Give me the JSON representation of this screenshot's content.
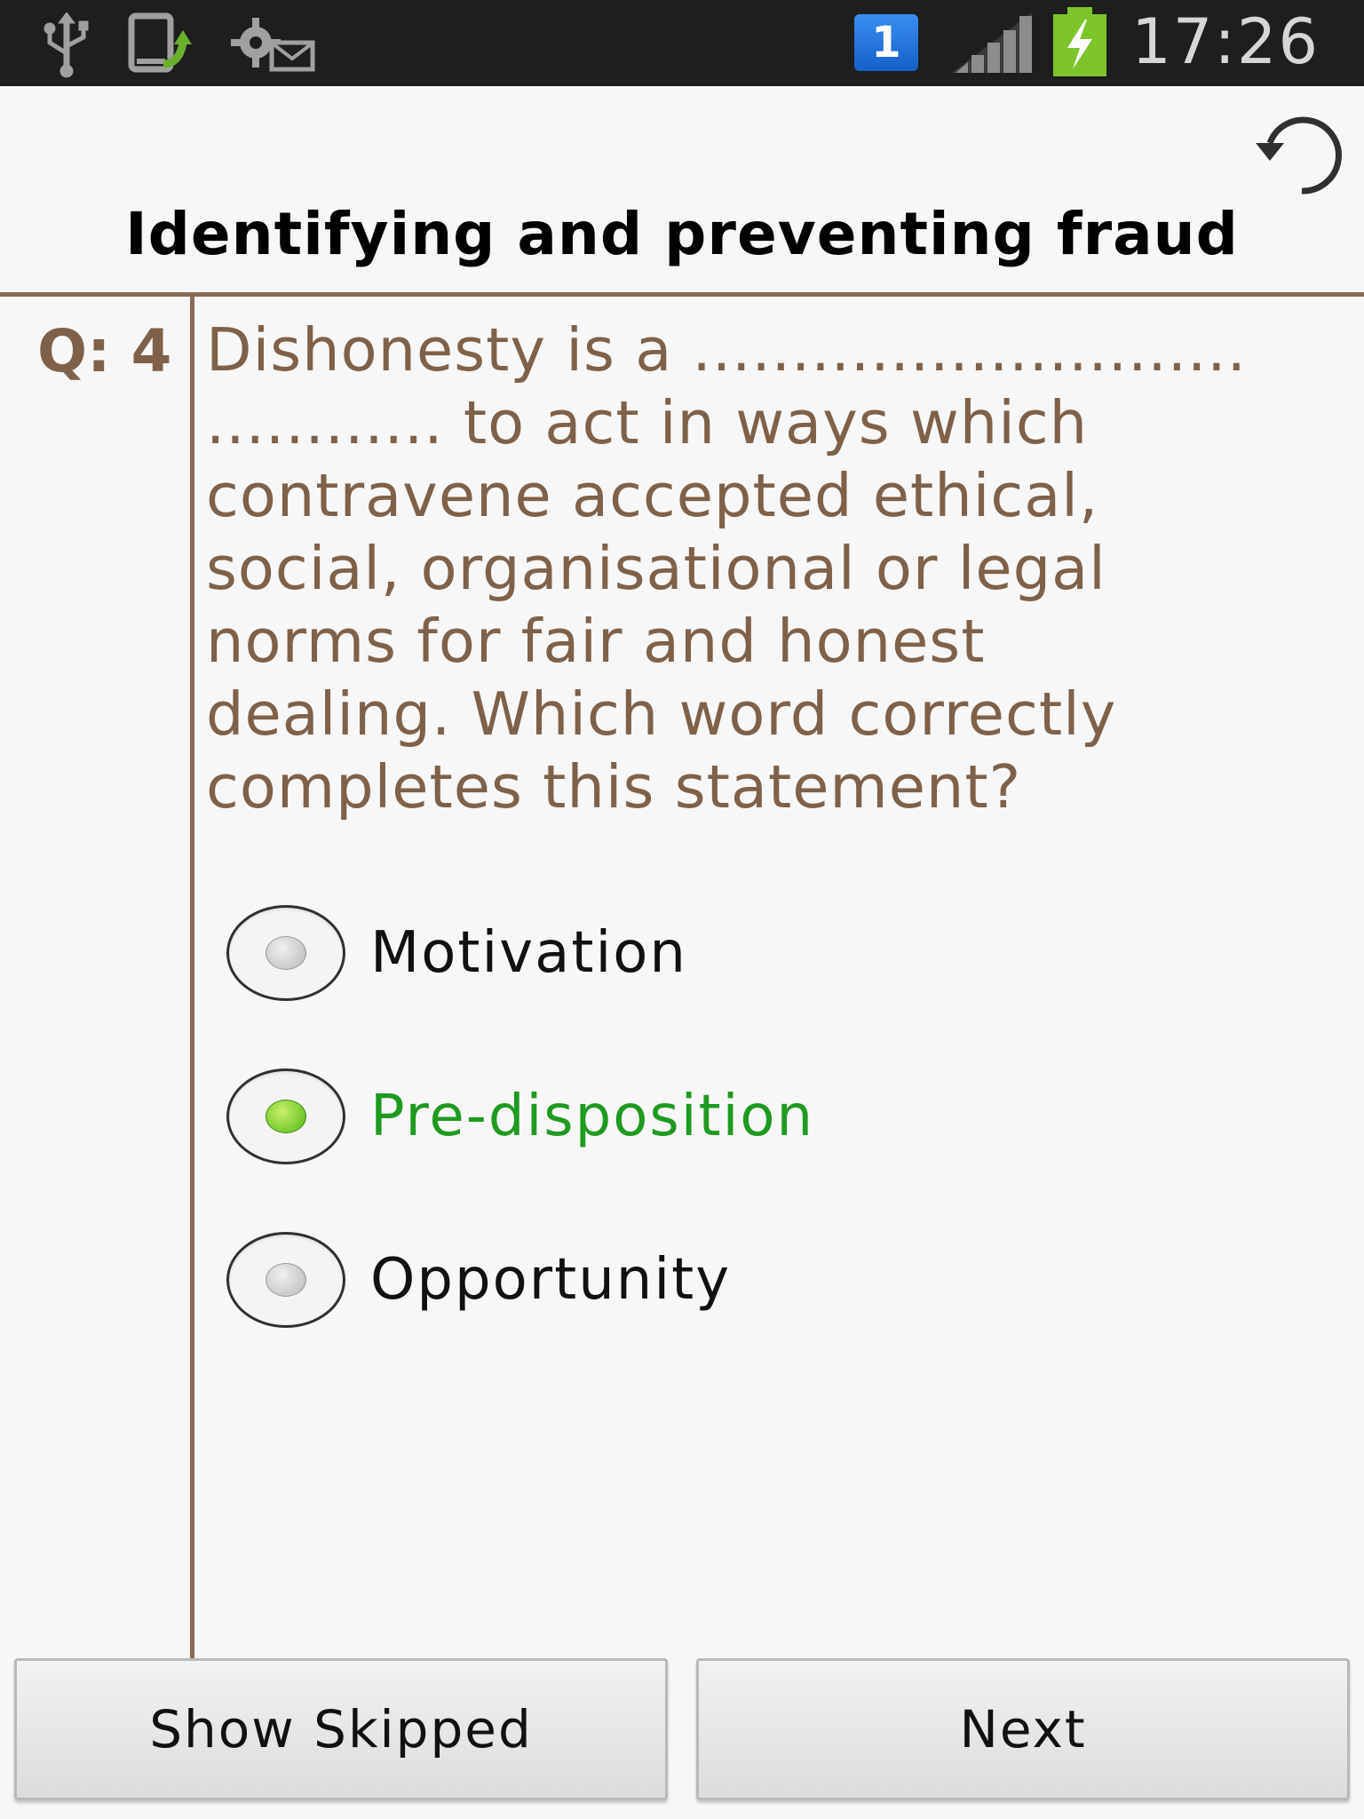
{
  "status_bar": {
    "clock": "17:26",
    "notification_badge": "1",
    "icons": [
      "usb-icon",
      "screen-share-icon",
      "settings-message-icon",
      "notification-badge-icon",
      "signal-icon",
      "battery-charging-icon"
    ]
  },
  "header": {
    "title": "Identifying and preventing fraud",
    "refresh_icon": "refresh-icon"
  },
  "question": {
    "number_label": "Q: 4",
    "text": "Dishonesty  is a ............................\n............ to act in ways which\ncontravene accepted ethical,\nsocial, organisational or legal\nnorms for fair and honest\ndealing. Which word correctly\ncompletes  this statement?"
  },
  "options": [
    {
      "label": "Motivation",
      "selected": false
    },
    {
      "label": "Pre-disposition",
      "selected": true
    },
    {
      "label": "Opportunity",
      "selected": false
    }
  ],
  "buttons": {
    "show_skipped": "Show Skipped",
    "next": "Next"
  },
  "colors": {
    "accent_brown": "#8a6a54",
    "question_text": "#7f6149",
    "selected_green": "#1f9a20",
    "status_bar_bg": "#1e1e1e"
  }
}
